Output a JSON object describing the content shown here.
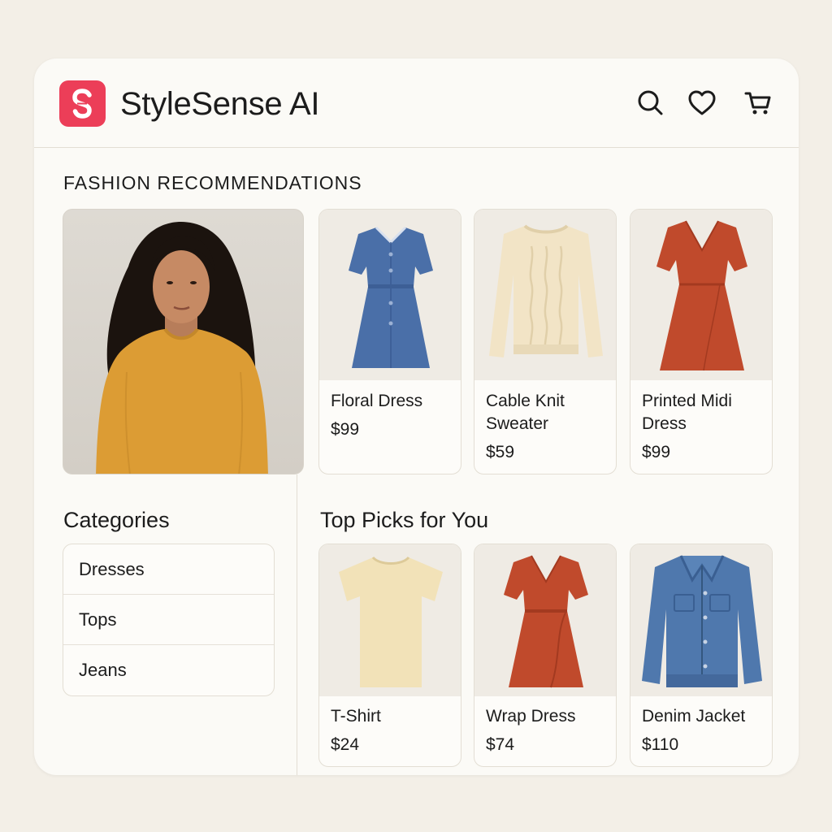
{
  "app": {
    "title": "StyleSense AI",
    "logo_letter": "S",
    "accent_color": "#ec3e58",
    "icons": [
      "search-icon",
      "heart-icon",
      "cart-icon"
    ]
  },
  "recommendations": {
    "heading": "FASHION RECOMMENDATIONS",
    "items": [
      {
        "name": "Floral Dress",
        "price": "$99",
        "image": "blue-dress"
      },
      {
        "name": "Cable Knit Sweater",
        "price": "$59",
        "image": "cream-sweater"
      },
      {
        "name": "Printed Midi Dress",
        "price": "$99",
        "image": "red-dress"
      }
    ]
  },
  "categories": {
    "heading": "Categories",
    "items": [
      "Dresses",
      "Tops",
      "Jeans"
    ]
  },
  "top_picks": {
    "heading": "Top Picks for You",
    "items": [
      {
        "name": "T-Shirt",
        "price": "$24",
        "image": "tshirt"
      },
      {
        "name": "Wrap Dress",
        "price": "$74",
        "image": "wrap-dress"
      },
      {
        "name": "Denim Jacket",
        "price": "$110",
        "image": "denim-jacket"
      }
    ]
  }
}
